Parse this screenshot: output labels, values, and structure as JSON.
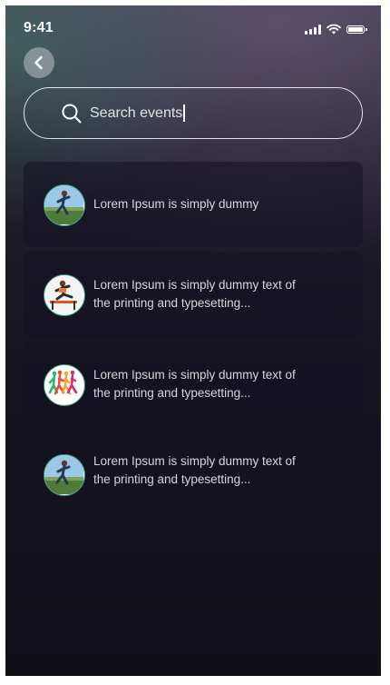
{
  "status_bar": {
    "time": "9:41",
    "icons": [
      "signal-icon",
      "wifi-icon",
      "battery-icon"
    ]
  },
  "header": {
    "back_icon": "chevron-left-icon"
  },
  "search": {
    "value": "Search events",
    "icon": "search-icon"
  },
  "events": [
    {
      "text": "Lorem Ipsum is simply dummy",
      "thumbnail": "runner-field-photo"
    },
    {
      "text": "Lorem Ipsum is simply dummy text of the printing and typesetting...",
      "thumbnail": "hurdle-runner-photo"
    },
    {
      "text": "Lorem Ipsum is simply dummy text of the printing and typesetting...",
      "thumbnail": "colorful-runners-illustration"
    },
    {
      "text": "Lorem Ipsum is simply dummy text of the printing and typesetting...",
      "thumbnail": "runner-field-photo"
    }
  ],
  "colors": {
    "background": "#15131f",
    "card": "#141320",
    "avatar_ring": "#2f9a78",
    "text": "#ffffff"
  }
}
